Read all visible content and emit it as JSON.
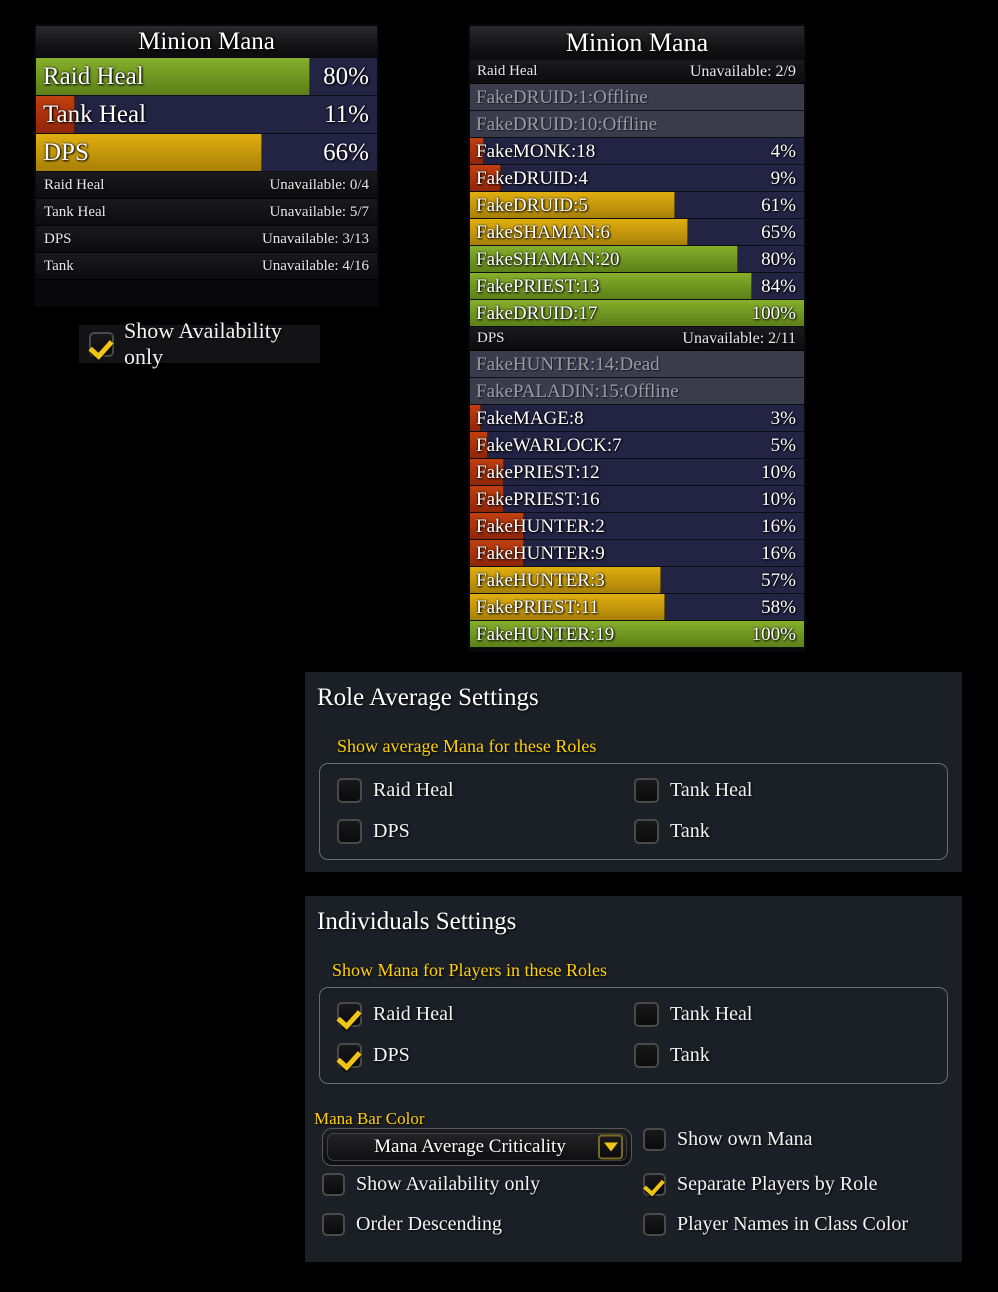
{
  "role_window": {
    "title": "Minion Mana",
    "bars": [
      {
        "label": "Raid Heal",
        "value": "80%",
        "pct": 80,
        "color": "green"
      },
      {
        "label": "Tank Heal",
        "value": "11%",
        "pct": 11,
        "color": "red"
      },
      {
        "label": "DPS",
        "value": "66%",
        "pct": 66,
        "color": "gold"
      }
    ],
    "unavailable": [
      {
        "label": "Raid Heal",
        "value": "Unavailable: 0/4"
      },
      {
        "label": "Tank Heal",
        "value": "Unavailable: 5/7"
      },
      {
        "label": "DPS",
        "value": "Unavailable: 3/13"
      },
      {
        "label": "Tank",
        "value": "Unavailable: 4/16"
      }
    ]
  },
  "availability_toggle": {
    "label": "Show Availability only",
    "checked": true
  },
  "player_window": {
    "title": "Minion Mana",
    "rows": [
      {
        "type": "header",
        "label": "Raid Heal",
        "value": "Unavailable: 2/9"
      },
      {
        "type": "offline",
        "label": "FakeDRUID:1:Offline",
        "value": "",
        "pct": 0,
        "color": ""
      },
      {
        "type": "offline",
        "label": "FakeDRUID:10:Offline",
        "value": "",
        "pct": 0,
        "color": ""
      },
      {
        "type": "bar",
        "label": "FakeMONK:18",
        "value": "4%",
        "pct": 4,
        "color": "red"
      },
      {
        "type": "bar",
        "label": "FakeDRUID:4",
        "value": "9%",
        "pct": 9,
        "color": "red"
      },
      {
        "type": "bar",
        "label": "FakeDRUID:5",
        "value": "61%",
        "pct": 61,
        "color": "gold"
      },
      {
        "type": "bar",
        "label": "FakeSHAMAN:6",
        "value": "65%",
        "pct": 65,
        "color": "gold"
      },
      {
        "type": "bar",
        "label": "FakeSHAMAN:20",
        "value": "80%",
        "pct": 80,
        "color": "green"
      },
      {
        "type": "bar",
        "label": "FakePRIEST:13",
        "value": "84%",
        "pct": 84,
        "color": "green"
      },
      {
        "type": "bar",
        "label": "FakeDRUID:17",
        "value": "100%",
        "pct": 100,
        "color": "green"
      },
      {
        "type": "header",
        "label": "DPS",
        "value": "Unavailable: 2/11"
      },
      {
        "type": "offline",
        "label": "FakeHUNTER:14:Dead",
        "value": "",
        "pct": 0,
        "color": ""
      },
      {
        "type": "offline",
        "label": "FakePALADIN:15:Offline",
        "value": "",
        "pct": 0,
        "color": ""
      },
      {
        "type": "bar",
        "label": "FakeMAGE:8",
        "value": "3%",
        "pct": 3,
        "color": "red"
      },
      {
        "type": "bar",
        "label": "FakeWARLOCK:7",
        "value": "5%",
        "pct": 5,
        "color": "red"
      },
      {
        "type": "bar",
        "label": "FakePRIEST:12",
        "value": "10%",
        "pct": 10,
        "color": "red"
      },
      {
        "type": "bar",
        "label": "FakePRIEST:16",
        "value": "10%",
        "pct": 10,
        "color": "red"
      },
      {
        "type": "bar",
        "label": "FakeHUNTER:2",
        "value": "16%",
        "pct": 16,
        "color": "red"
      },
      {
        "type": "bar",
        "label": "FakeHUNTER:9",
        "value": "16%",
        "pct": 16,
        "color": "red"
      },
      {
        "type": "bar",
        "label": "FakeHUNTER:3",
        "value": "57%",
        "pct": 57,
        "color": "gold"
      },
      {
        "type": "bar",
        "label": "FakePRIEST:11",
        "value": "58%",
        "pct": 58,
        "color": "gold"
      },
      {
        "type": "bar",
        "label": "FakeHUNTER:19",
        "value": "100%",
        "pct": 100,
        "color": "green"
      }
    ]
  },
  "role_settings": {
    "title": "Role Average Settings",
    "group_label": "Show average Mana for these Roles",
    "checkboxes": [
      {
        "label": "Raid Heal",
        "checked": false
      },
      {
        "label": "Tank Heal",
        "checked": false
      },
      {
        "label": "DPS",
        "checked": false
      },
      {
        "label": "Tank",
        "checked": false
      }
    ]
  },
  "individuals_settings": {
    "title": "Individuals Settings",
    "group_label": "Show Mana for Players in these Roles",
    "checkboxes": [
      {
        "label": "Raid Heal",
        "checked": true
      },
      {
        "label": "Tank Heal",
        "checked": false
      },
      {
        "label": "DPS",
        "checked": true
      },
      {
        "label": "Tank",
        "checked": false
      }
    ],
    "dropdown": {
      "label": "Mana Bar Color",
      "selected": "Mana Average Criticality"
    },
    "options": [
      {
        "label": "Show own Mana",
        "checked": false
      },
      {
        "label": "Show Availability only",
        "checked": false
      },
      {
        "label": "Separate Players by Role",
        "checked": true
      },
      {
        "label": "Order Descending",
        "checked": false
      },
      {
        "label": "Player Names in Class Color",
        "checked": false
      }
    ]
  },
  "colors": {
    "green": "#6d9420",
    "gold": "#c2960b",
    "red": "#a8300c",
    "row_bg": "#232344",
    "accent": "#ffd100",
    "check": "#f0c514"
  }
}
